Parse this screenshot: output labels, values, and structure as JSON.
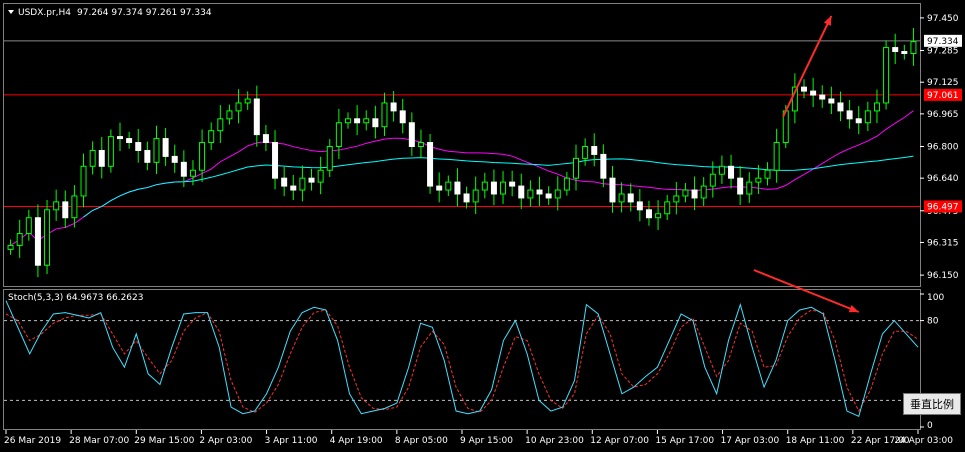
{
  "chart_data": [
    {
      "type": "candlestick",
      "header": {
        "symbol": "USDX.pr,H4",
        "ohlc": "97.264 97.374 97.261 97.334"
      },
      "ylim": [
        96.1,
        97.5
      ],
      "y_ticks": [
        "97.450",
        "97.285",
        "97.125",
        "96.965",
        "96.800",
        "96.640",
        "96.475",
        "96.315",
        "96.150"
      ],
      "current_price": {
        "label": "97.334",
        "value": 97.334
      },
      "horizontal_lines": [
        {
          "label": "97.061",
          "value": 97.061
        },
        {
          "label": "96.497",
          "value": 96.497
        }
      ],
      "x_ticks": [
        "26 Mar 2019",
        "28 Mar 07:00",
        "29 Mar 15:00",
        "2 Apr 03:00",
        "3 Apr 11:00",
        "4 Apr 19:00",
        "8 Apr 05:00",
        "9 Apr 15:00",
        "10 Apr 23:00",
        "12 Apr 07:00",
        "15 Apr 17:00",
        "17 Apr 03:00",
        "18 Apr 11:00",
        "22 Apr 17:00",
        "24 Apr 03:00"
      ],
      "closes": [
        96.3,
        96.36,
        96.44,
        96.2,
        96.48,
        96.52,
        96.44,
        96.55,
        96.7,
        96.78,
        96.7,
        96.85,
        96.84,
        96.82,
        96.78,
        96.72,
        96.84,
        96.75,
        96.72,
        96.65,
        96.68,
        96.82,
        96.88,
        96.94,
        96.98,
        97.02,
        97.04,
        96.86,
        96.82,
        96.64,
        96.6,
        96.58,
        96.64,
        96.62,
        96.68,
        96.8,
        96.92,
        96.94,
        96.92,
        96.94,
        96.9,
        97.02,
        96.98,
        96.92,
        96.8,
        96.82,
        96.6,
        96.58,
        96.62,
        96.56,
        96.52,
        96.58,
        96.62,
        96.56,
        96.62,
        96.6,
        96.54,
        96.58,
        96.56,
        96.54,
        96.58,
        96.64,
        96.74,
        96.8,
        96.76,
        96.64,
        96.52,
        96.56,
        96.52,
        96.48,
        96.44,
        96.46,
        96.52,
        96.55,
        96.58,
        96.54,
        96.6,
        96.66,
        96.7,
        96.64,
        96.56,
        96.62,
        96.64,
        96.68,
        96.82,
        96.98,
        97.1,
        97.08,
        97.06,
        97.04,
        97.02,
        96.98,
        96.94,
        96.92,
        96.98,
        97.02,
        97.3,
        97.28,
        97.27,
        97.33
      ],
      "indicators": [
        {
          "type": "moving-average",
          "color": "#ff00ff",
          "period": 20
        },
        {
          "type": "moving-average",
          "color": "#00ffff",
          "period": 60
        }
      ],
      "annotations": [
        {
          "type": "arrow",
          "color": "#ff2a2a",
          "from_x": 0.852,
          "from_y": 96.95,
          "to_x": 0.905,
          "to_y": 97.46
        }
      ]
    },
    {
      "type": "line",
      "title": "Stoch(5,3,3) 64.9673 66.2623",
      "ylim": [
        0,
        100
      ],
      "y_ticks": [
        "100",
        "80",
        "20",
        "0"
      ],
      "levels": [
        80,
        20
      ],
      "k_values": [
        95,
        75,
        55,
        72,
        85,
        86,
        84,
        82,
        86,
        60,
        45,
        70,
        40,
        32,
        60,
        85,
        86,
        86,
        60,
        15,
        10,
        12,
        25,
        45,
        72,
        86,
        90,
        88,
        65,
        25,
        10,
        12,
        14,
        18,
        45,
        78,
        75,
        50,
        12,
        10,
        12,
        28,
        65,
        80,
        55,
        20,
        12,
        15,
        35,
        92,
        85,
        55,
        25,
        30,
        38,
        45,
        65,
        85,
        80,
        45,
        25,
        65,
        92,
        60,
        30,
        50,
        80,
        88,
        90,
        85,
        50,
        12,
        8,
        40,
        70,
        80,
        70,
        60
      ],
      "d_values": [
        85,
        80,
        65,
        70,
        78,
        82,
        84,
        84,
        85,
        70,
        55,
        65,
        52,
        40,
        50,
        72,
        82,
        86,
        72,
        35,
        15,
        11,
        18,
        32,
        55,
        75,
        86,
        88,
        76,
        45,
        22,
        14,
        13,
        15,
        30,
        60,
        72,
        62,
        30,
        14,
        11,
        20,
        45,
        68,
        65,
        40,
        20,
        14,
        25,
        70,
        84,
        70,
        40,
        30,
        32,
        40,
        55,
        75,
        82,
        60,
        38,
        50,
        78,
        72,
        45,
        46,
        68,
        82,
        88,
        86,
        65,
        30,
        12,
        28,
        55,
        72,
        72,
        66
      ],
      "annotations": [
        {
          "type": "arrow",
          "color": "#ff2a2a",
          "from_x": 0.82,
          "from_y": 270,
          "to_x": 0.935,
          "to_y": 312
        }
      ]
    }
  ],
  "ui": {
    "scale_button_label": "垂直比例"
  }
}
